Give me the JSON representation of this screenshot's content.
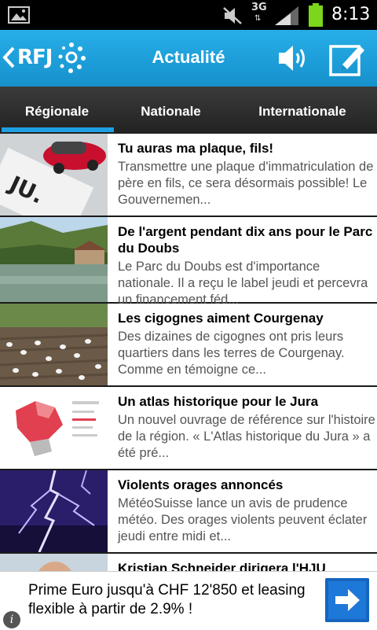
{
  "status_bar": {
    "network": "3G",
    "time": "8:13"
  },
  "app": {
    "logo": "RFJ",
    "title": "Actualité"
  },
  "tabs": [
    {
      "label": "Régionale",
      "selected": true
    },
    {
      "label": "Nationale",
      "selected": false
    },
    {
      "label": "Internationale",
      "selected": false
    }
  ],
  "articles": [
    {
      "title": "Tu auras ma plaque, fils!",
      "summary": "Transmettre une plaque d'immatriculation de père en fils, ce sera désormais possible! Le Gouvernemen..."
    },
    {
      "title": "De l'argent pendant dix ans pour le Parc du Doubs",
      "summary": "Le Parc du Doubs est d'importance nationale. Il a reçu le label jeudi et percevra un financement féd..."
    },
    {
      "title": "Les cigognes aiment Courgenay",
      "summary": "Des dizaines de cigognes ont pris leurs quartiers dans les terres de Courgenay. Comme en témoigne ce..."
    },
    {
      "title": "Un atlas historique pour le Jura",
      "summary": "Un nouvel ouvrage de référence sur l'histoire de la région. « L'Atlas historique du Jura » a été pré..."
    },
    {
      "title": "Violents orages annoncés",
      "summary": "MétéoSuisse lance un avis de prudence météo. Des orages violents peuvent éclater jeudi entre midi et..."
    },
    {
      "title": "Kristian Schneider dirigera l'HJU",
      "summary": ""
    }
  ],
  "ad": {
    "text": "Prime Euro jusqu'à CHF 12'850 et leasing flexible à partir de 2.9% !",
    "info": "i"
  },
  "colors": {
    "appbar": "#1ea0dc",
    "tab_indicator": "#1fa0e3",
    "ad_button": "#1565c0"
  }
}
